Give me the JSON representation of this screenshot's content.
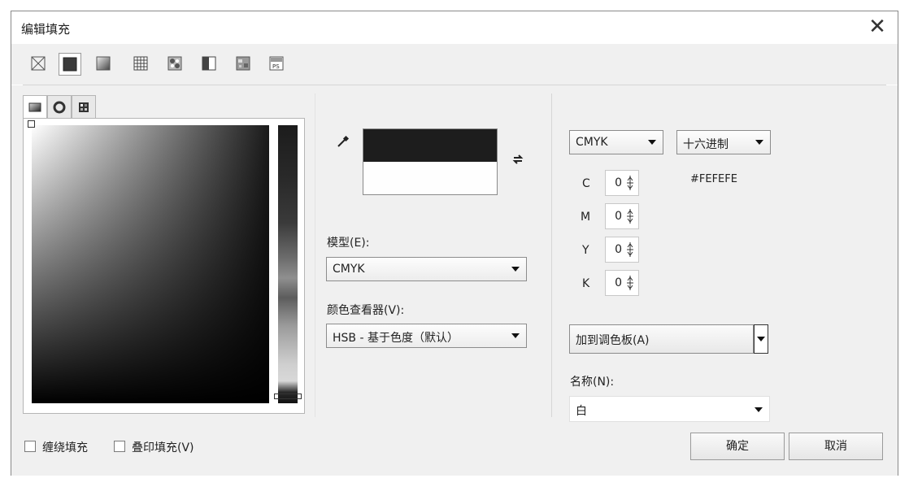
{
  "window": {
    "title": "编辑填充",
    "close_glyph": "✕"
  },
  "toolbar": {
    "buttons": [
      {
        "icon": "no-fill-icon",
        "active": false
      },
      {
        "icon": "uniform-fill-icon",
        "active": true
      },
      {
        "icon": "fountain-fill-icon",
        "active": false
      },
      {
        "icon": "vector-pattern-fill-icon",
        "active": false
      },
      {
        "icon": "bitmap-pattern-fill-icon",
        "active": false
      },
      {
        "icon": "two-color-pattern-fill-icon",
        "active": false
      },
      {
        "icon": "texture-fill-icon",
        "active": false
      },
      {
        "icon": "postscript-fill-icon",
        "active": false
      }
    ]
  },
  "picker": {
    "tabs": [
      "color-viewer-tab-icon",
      "color-wheel-tab-icon",
      "palette-tab-icon"
    ]
  },
  "swatch": {
    "old_color": "#1d1d1d",
    "new_color": "#fefefe"
  },
  "model": {
    "label": "模型(E):",
    "value": "CMYK"
  },
  "viewer": {
    "label": "颜色查看器(V):",
    "value": "HSB - 基于色度（默认）"
  },
  "values": {
    "model_select": "CMYK",
    "format_select": "十六进制",
    "hex": "#FEFEFE",
    "channels": [
      {
        "name": "C",
        "value": "0"
      },
      {
        "name": "M",
        "value": "0"
      },
      {
        "name": "Y",
        "value": "0"
      },
      {
        "name": "K",
        "value": "0"
      }
    ]
  },
  "add_to_palette": {
    "label": "加到调色板(A)"
  },
  "name": {
    "label": "名称(N):",
    "value": "白"
  },
  "footer": {
    "wrap_fill": "缠绕填充",
    "overprint_fill": "叠印填充(V)",
    "ok": "确定",
    "cancel": "取消"
  }
}
